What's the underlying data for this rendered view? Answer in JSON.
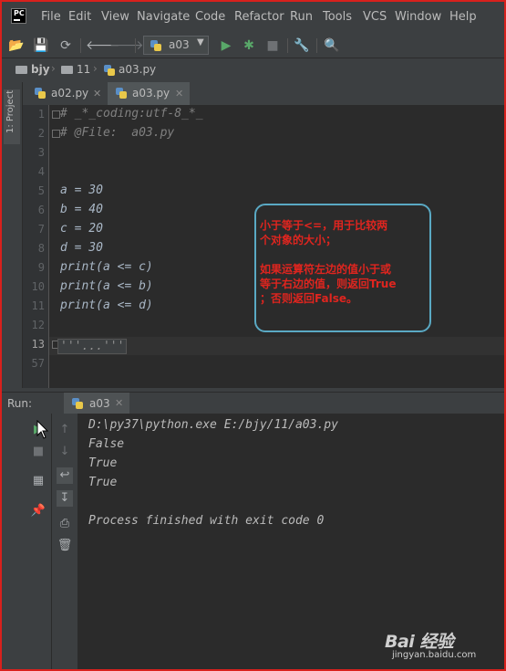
{
  "menu": {
    "logo": "PC",
    "items": [
      "File",
      "Edit",
      "View",
      "Navigate",
      "Code",
      "Refactor",
      "Run",
      "Tools",
      "VCS",
      "Window",
      "Help"
    ]
  },
  "toolbar": {
    "run_config": "a03"
  },
  "navbar": {
    "crumbs": [
      "bjy",
      "11",
      "a03.py"
    ]
  },
  "side": {
    "project_label": "1: Project"
  },
  "tabs": [
    {
      "label": "a02.py",
      "active": false
    },
    {
      "label": "a03.py",
      "active": true
    }
  ],
  "editor": {
    "line_numbers": [
      "1",
      "2",
      "3",
      "4",
      "5",
      "6",
      "7",
      "8",
      "9",
      "10",
      "11",
      "12",
      "13",
      "57"
    ],
    "lines": [
      "# _*_coding:utf-8_*_",
      "# @File:  a03.py",
      "",
      "",
      "a = 30",
      "b = 40",
      "c = 20",
      "d = 30",
      "print(a <= c)",
      "print(a <= b)",
      "print(a <= d)",
      "",
      "'''...'''",
      ""
    ]
  },
  "callout": {
    "line1": "小于等于<=，用于比较两",
    "line2": "个对象的大小；",
    "line3": "如果运算符左边的值小于或",
    "line4": "等于右边的值，则返回True",
    "line5": "；否则返回False。"
  },
  "run": {
    "label": "Run:",
    "tab": "a03",
    "output": [
      "D:\\py37\\python.exe E:/bjy/11/a03.py",
      "False",
      "True",
      "True",
      "",
      "Process finished with exit code 0"
    ]
  },
  "watermark": {
    "brand": "Bai 经验",
    "url": "jingyan.baidu.com"
  },
  "colors": {
    "accent_border": "#d8211d",
    "callout_border": "#5aa9c4",
    "callout_text": "#e0251f"
  }
}
